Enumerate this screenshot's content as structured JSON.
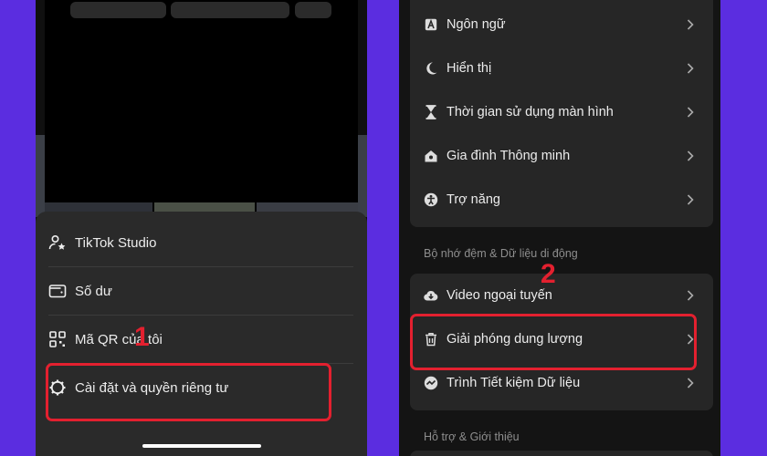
{
  "left_menu": {
    "items": [
      {
        "label": "TikTok Studio",
        "icon": "person-star-icon"
      },
      {
        "label": "Số dư",
        "icon": "wallet-icon"
      },
      {
        "label": "Mã QR của tôi",
        "icon": "qr-code-icon"
      },
      {
        "label": "Cài đặt và quyền riêng tư",
        "icon": "gear-icon"
      }
    ]
  },
  "right_menu": {
    "group1": [
      {
        "label": "Ngôn ngữ",
        "icon": "language-icon"
      },
      {
        "label": "Hiển thị",
        "icon": "moon-icon"
      },
      {
        "label": "Thời gian sử dụng màn hình",
        "icon": "hourglass-icon"
      },
      {
        "label": "Gia đình Thông minh",
        "icon": "house-icon"
      },
      {
        "label": "Trợ năng",
        "icon": "accessibility-icon"
      }
    ],
    "section_cache": "Bộ nhớ đệm & Dữ liệu di động",
    "group2": [
      {
        "label": "Video ngoại tuyến",
        "icon": "cloud-download-icon"
      },
      {
        "label": "Giải phóng dung lượng",
        "icon": "trash-icon"
      },
      {
        "label": "Trình Tiết kiệm Dữ liệu",
        "icon": "data-saver-icon"
      }
    ],
    "section_support": "Hỗ trợ & Giới thiệu"
  },
  "annotations": {
    "step1": "1",
    "step2": "2",
    "highlight_color": "#e3202f"
  },
  "colors": {
    "background": "#5b2de0",
    "sheet": "#2a2a2a",
    "card": "#262626"
  }
}
